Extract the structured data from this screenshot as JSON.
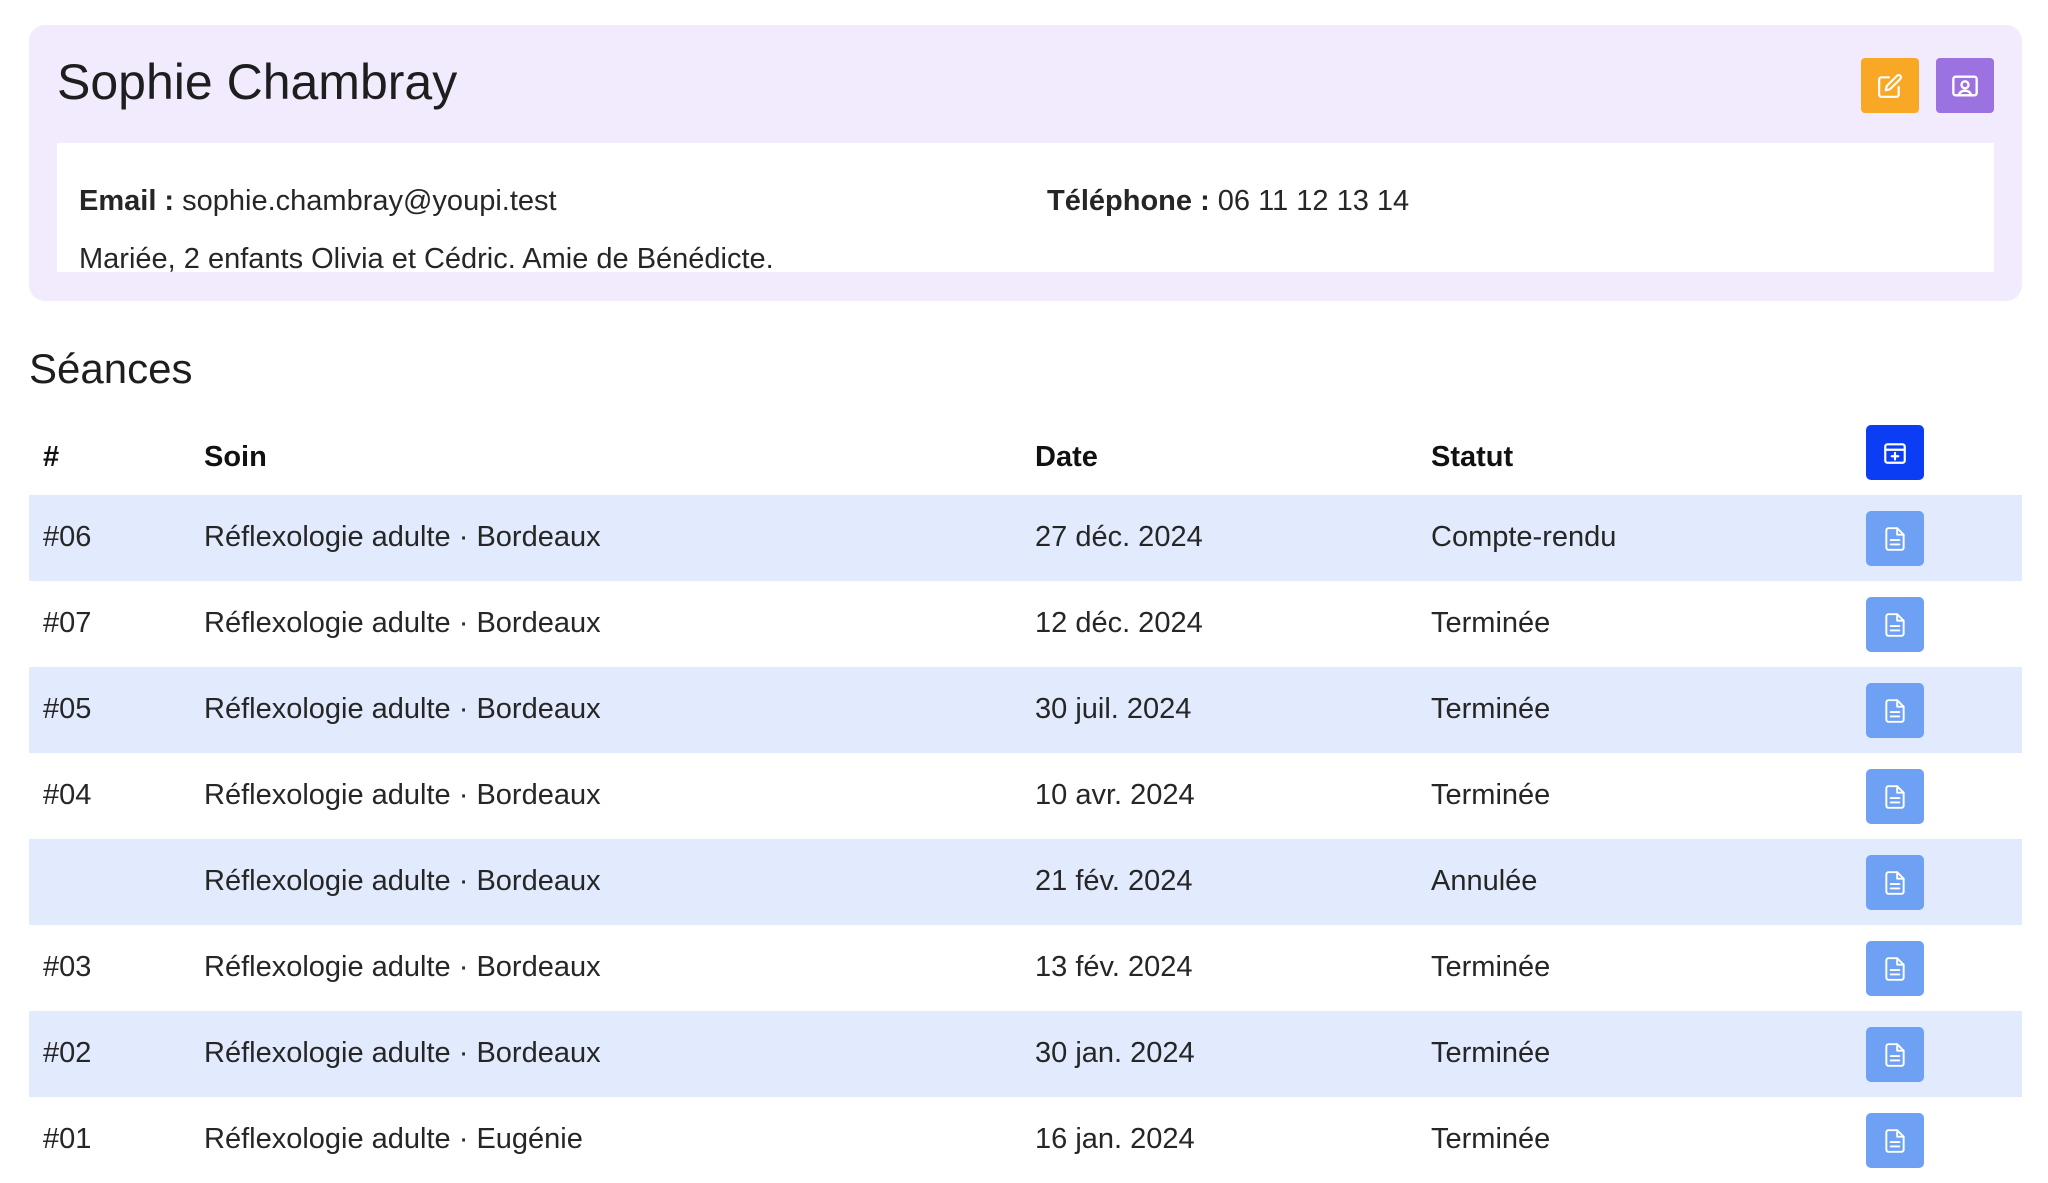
{
  "client": {
    "name": "Sophie Chambray",
    "email_label": "Email :",
    "email": "sophie.chambray@youpi.test",
    "phone_label": "Téléphone :",
    "phone": "06 11 12 13 14",
    "note": "Mariée, 2 enfants Olivia et Cédric. Amie de Bénédicte."
  },
  "actions": {
    "edit_icon": "edit-icon",
    "profile_icon": "contact-card-icon",
    "edit_color": "#f9a825",
    "profile_color": "#9b72e0"
  },
  "sessions": {
    "title": "Séances",
    "headers": {
      "num": "#",
      "soin": "Soin",
      "date": "Date",
      "statut": "Statut"
    },
    "add_icon": "calendar-plus-icon",
    "row_icon": "document-icon",
    "rows": [
      {
        "num": "#06",
        "soin": "Réflexologie adulte · Bordeaux",
        "date": "27 déc. 2024",
        "statut": "Compte-rendu"
      },
      {
        "num": "#07",
        "soin": "Réflexologie adulte · Bordeaux",
        "date": "12 déc. 2024",
        "statut": "Terminée"
      },
      {
        "num": "#05",
        "soin": "Réflexologie adulte · Bordeaux",
        "date": "30 juil. 2024",
        "statut": "Terminée"
      },
      {
        "num": "#04",
        "soin": "Réflexologie adulte · Bordeaux",
        "date": "10 avr. 2024",
        "statut": "Terminée"
      },
      {
        "num": "",
        "soin": "Réflexologie adulte · Bordeaux",
        "date": "21 fév. 2024",
        "statut": "Annulée"
      },
      {
        "num": "#03",
        "soin": "Réflexologie adulte · Bordeaux",
        "date": "13 fév. 2024",
        "statut": "Terminée"
      },
      {
        "num": "#02",
        "soin": "Réflexologie adulte · Bordeaux",
        "date": "30 jan. 2024",
        "statut": "Terminée"
      },
      {
        "num": "#01",
        "soin": "Réflexologie adulte · Eugénie",
        "date": "16 jan. 2024",
        "statut": "Terminée"
      }
    ]
  }
}
